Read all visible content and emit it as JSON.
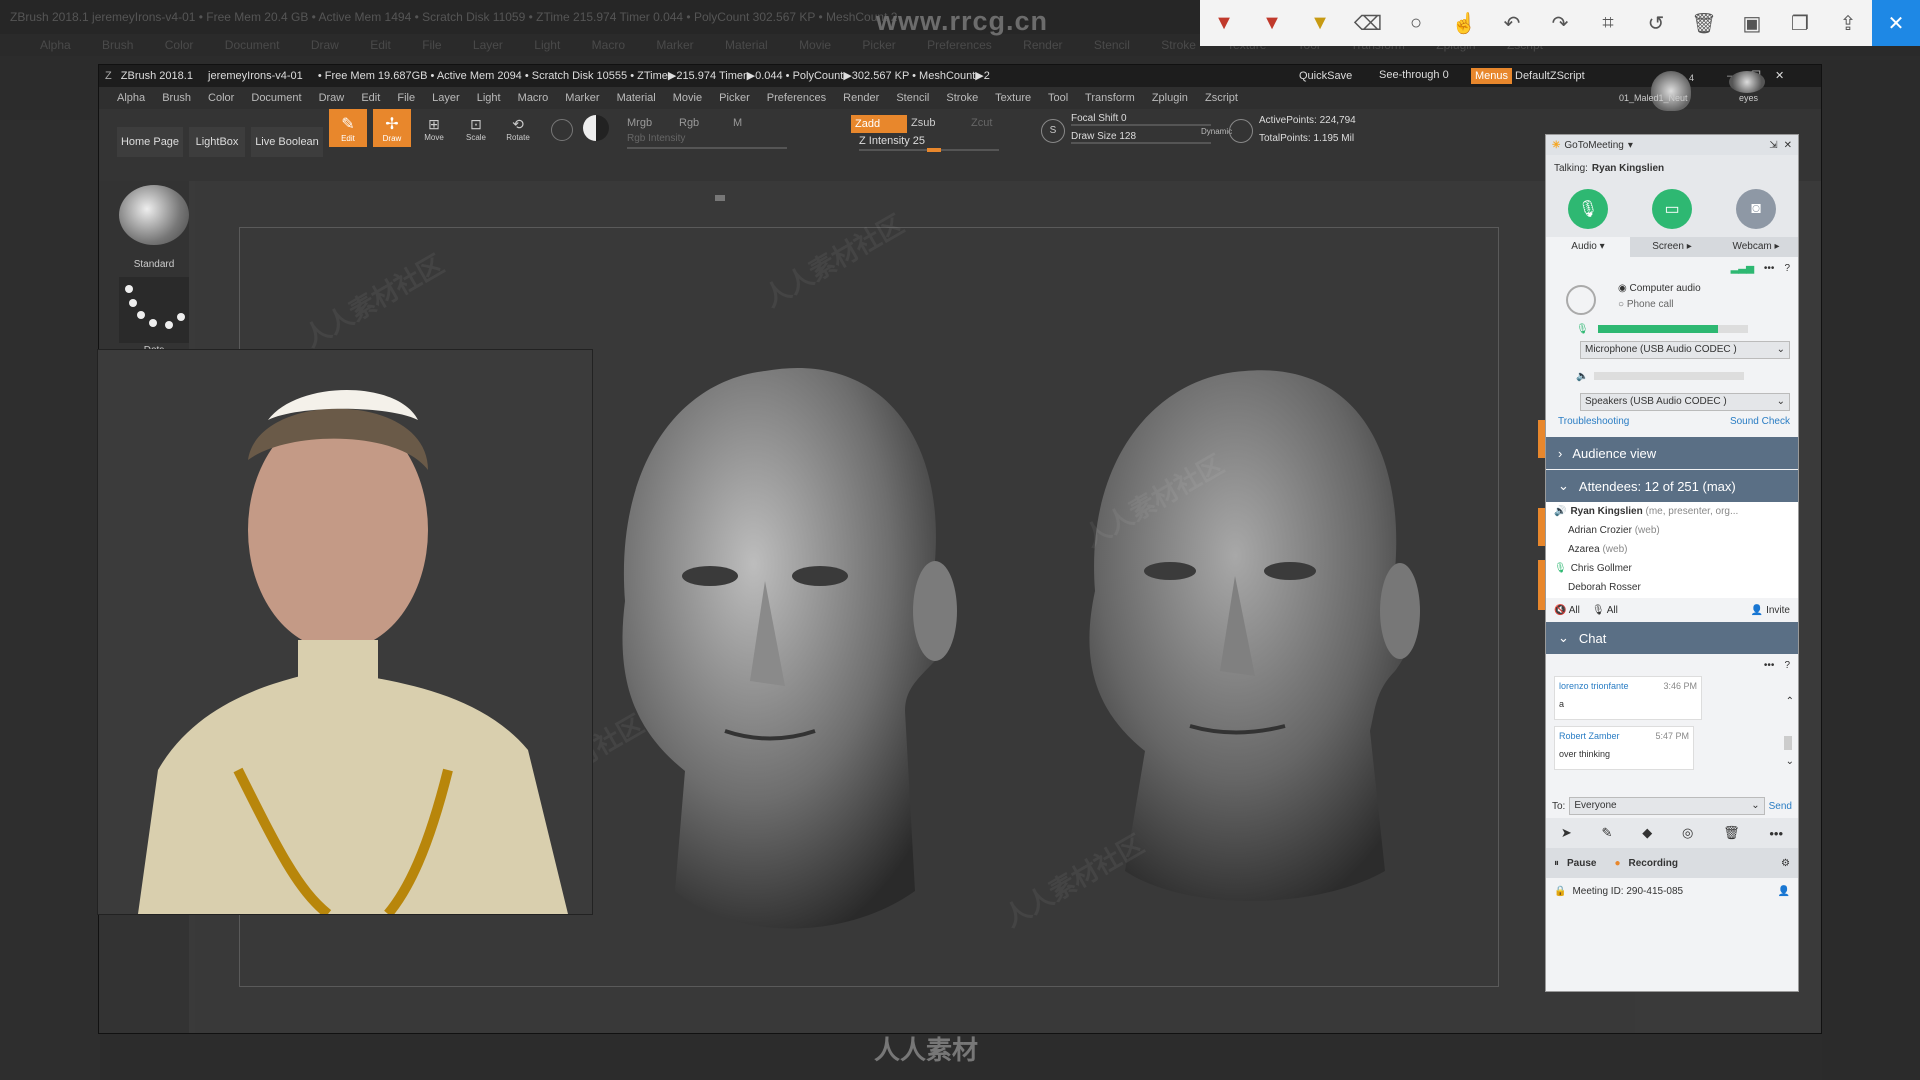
{
  "background": {
    "title_text": "ZBrush 2018.1  jeremeyIrons-v4-01  • Free Mem 20.4 GB • Active Mem 1494 • Scratch Disk 11059 • ZTime 215.974 Timer 0.044 • PolyCount 302.567 KP • MeshCount 2",
    "menu_items": [
      "Alpha",
      "Brush",
      "Color",
      "Document",
      "Draw",
      "Edit",
      "File",
      "Layer",
      "Light",
      "Macro",
      "Marker",
      "Material",
      "Movie",
      "Picker",
      "Preferences",
      "Render",
      "Stencil",
      "Stroke",
      "Texture",
      "Tool",
      "Transform",
      "Zplugin",
      "Zscript"
    ],
    "watermark": "www.rrcg.cn"
  },
  "annotation_toolbar": {
    "tools": [
      "pen-red-icon",
      "marker-red-icon",
      "highlighter-icon",
      "eraser-icon",
      "shape-icon",
      "pointer-icon",
      "undo-icon",
      "redo-icon",
      "crop-icon",
      "history-icon",
      "delete-icon",
      "save-icon",
      "copy-icon",
      "share-icon",
      "close-icon"
    ],
    "accent": "#1e88e5"
  },
  "zbrush": {
    "title": "ZBrush 2018.1",
    "doc": "jeremeyIrons-v4-01",
    "stats": "• Free Mem 19.687GB • Active Mem 2094 • Scratch Disk 10555 • ZTime▶215.974 Timer▶0.044 • PolyCount▶302.567 KP • MeshCount▶2",
    "quicksave": "QuickSave",
    "see_through": "See-through  0",
    "menus_label": "Menus",
    "default_zscript": "DefaultZScript",
    "menu_items": [
      "Alpha",
      "Brush",
      "Color",
      "Document",
      "Draw",
      "Edit",
      "File",
      "Layer",
      "Light",
      "Macro",
      "Marker",
      "Material",
      "Movie",
      "Picker",
      "Preferences",
      "Render",
      "Stencil",
      "Stroke",
      "Texture",
      "Tool",
      "Transform",
      "Zplugin",
      "Zscript"
    ],
    "toolbar": {
      "home_page": "Home Page",
      "lightbox": "LightBox",
      "live_boolean": "Live Boolean",
      "edit": "Edit",
      "draw": "Draw",
      "move": "Move",
      "scale": "Scale",
      "rotate": "Rotate",
      "mrgb": "Mrgb",
      "rgb": "Rgb",
      "m": "M",
      "rgb_intensity": "Rgb Intensity",
      "zadd": "Zadd",
      "zsub": "Zsub",
      "zcut": "Zcut",
      "z_intensity": "Z Intensity 25",
      "focal_shift": "Focal Shift 0",
      "draw_size": "Draw Size 128",
      "dynamic": "Dynamic",
      "active_points": "ActivePoints: 224,794",
      "total_points": "TotalPoints: 1.195 Mil",
      "material_1": "01_Maled1_Neut",
      "material_2": "eyes",
      "material_count": "4"
    },
    "brushes": {
      "standard": "Standard",
      "dots": "Dots"
    },
    "accent": "#e8872c"
  },
  "gotomeeting": {
    "title": "GoToMeeting",
    "talking_label": "Talking:",
    "talking_name": "Ryan Kingslien",
    "tabs": [
      "Audio",
      "Screen",
      "Webcam"
    ],
    "computer_audio": "Computer audio",
    "phone_call": "Phone call",
    "microphone": "Microphone (USB Audio CODEC )",
    "speakers": "Speakers (USB Audio CODEC )",
    "troubleshooting": "Troubleshooting",
    "sound_check": "Sound Check",
    "audience_view": "Audience view",
    "attendees_header": "Attendees:  12 of 251 (max)",
    "attendees": [
      {
        "name": "Ryan Kingslien",
        "note": "(me, presenter, org..."
      },
      {
        "name": "Adrian Crozier",
        "note": "(web)"
      },
      {
        "name": "Azarea",
        "note": "(web)"
      },
      {
        "name": "Chris Gollmer",
        "note": ""
      },
      {
        "name": "Deborah Rosser",
        "note": ""
      }
    ],
    "all_1": "All",
    "all_2": "All",
    "invite": "Invite",
    "chat_header": "Chat",
    "messages": [
      {
        "sender": "lorenzo trionfante",
        "time": "3:46 PM",
        "text": "a"
      },
      {
        "sender": "Robert Zamber",
        "time": "5:47 PM",
        "text": "over thinking"
      }
    ],
    "to_label": "To:",
    "to_value": "Everyone",
    "send": "Send",
    "pause": "Pause",
    "recording": "Recording",
    "meeting_id": "Meeting ID: 290-415-085",
    "colors": {
      "green": "#2eb872",
      "header_blue": "#5a6f85",
      "link": "#2a7dc4"
    }
  },
  "footer_logo": "人人素材"
}
